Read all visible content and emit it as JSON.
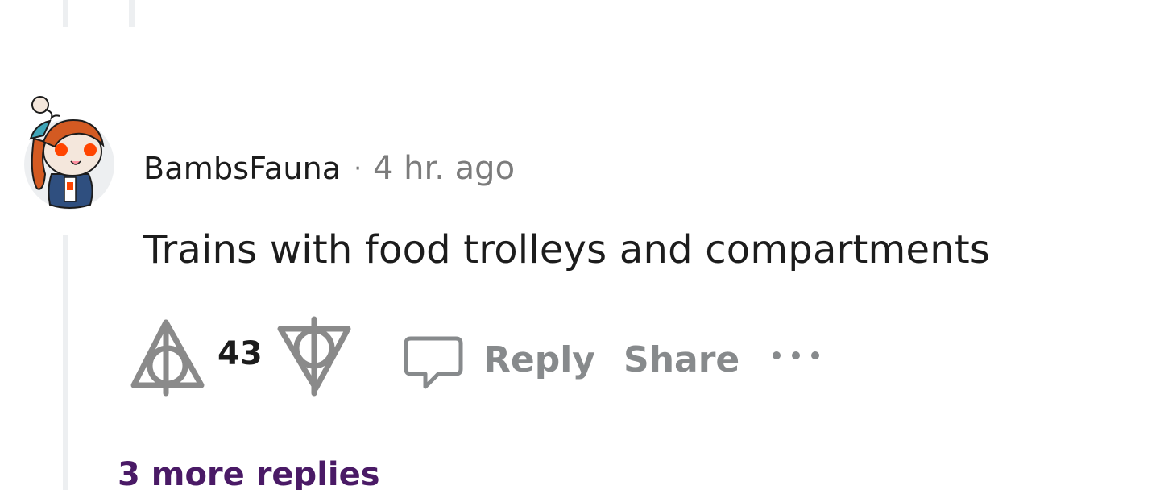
{
  "comment": {
    "username": "BambsFauna",
    "separator": "·",
    "timestamp": "4 hr. ago",
    "body": "Trains with food trolleys and compartments",
    "score": "43"
  },
  "actions": {
    "reply_label": "Reply",
    "share_label": "Share",
    "more_icon": "ellipsis-icon",
    "upvote_icon": "upvote-arrow-icon",
    "downvote_icon": "downvote-arrow-icon",
    "reply_icon": "comment-bubble-icon"
  },
  "thread": {
    "more_replies_label": "3 more replies"
  },
  "colors": {
    "text_primary": "#1c1c1c",
    "text_meta": "#7c7c7c",
    "action_gray": "#878a8c",
    "thread_line": "#edeff1",
    "more_replies": "#4a1a66",
    "avatar_hair": "#d35a22",
    "avatar_eyes": "#ff4500"
  }
}
